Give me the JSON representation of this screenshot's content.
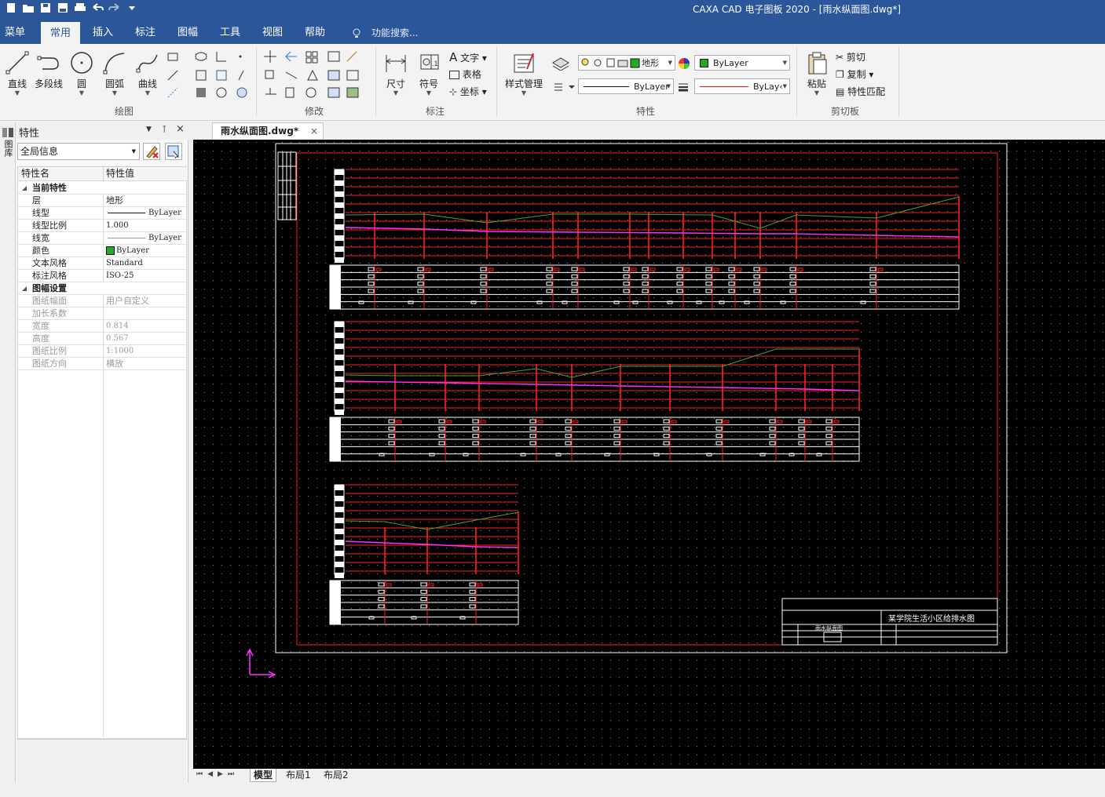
{
  "window": {
    "title": "CAXA CAD 电子图板 2020 - [雨水纵面图.dwg*]"
  },
  "menu": {
    "tabs": [
      "菜单",
      "常用",
      "插入",
      "标注",
      "图幅",
      "工具",
      "视图",
      "帮助"
    ],
    "active_tab": "常用",
    "search_placeholder": "功能搜索..."
  },
  "ribbon": {
    "draw": {
      "group_label": "绘图",
      "line": "直线",
      "polyline": "多段线",
      "circle": "圆",
      "arc": "圆弧",
      "curve": "曲线"
    },
    "modify": {
      "group_label": "修改"
    },
    "annotate": {
      "group_label": "标注",
      "dimension": "尺寸",
      "symbol": "符号",
      "text": "文字",
      "table": "表格",
      "coordinate": "坐标"
    },
    "properties": {
      "group_label": "特性",
      "style_manage": "样式管理",
      "layer_value": "地形",
      "color_value": "ByLayer",
      "linetype_value": "ByLayer",
      "lineweight_value": "ByLay‹"
    },
    "clipboard": {
      "group_label": "剪切板",
      "paste": "粘贴",
      "cut": "剪切",
      "copy": "复制",
      "match": "特性匹配"
    }
  },
  "left_strip": {
    "label": "图库"
  },
  "properties_panel": {
    "title": "特性",
    "scope": "全局信息",
    "col_name": "特性名",
    "col_value": "特性值",
    "groups": [
      {
        "name": "当前特性",
        "rows": [
          {
            "name": "层",
            "value": "地形"
          },
          {
            "name": "线型",
            "value": "ByLayer"
          },
          {
            "name": "线型比例",
            "value": "1.000"
          },
          {
            "name": "线宽",
            "value": "ByLayer"
          },
          {
            "name": "颜色",
            "value": "ByLayer"
          },
          {
            "name": "文本风格",
            "value": "Standard"
          },
          {
            "name": "标注风格",
            "value": "ISO-25"
          }
        ]
      },
      {
        "name": "图幅设置",
        "rows": [
          {
            "name": "图纸幅面",
            "value": "用户自定义"
          },
          {
            "name": "加长系数",
            "value": ""
          },
          {
            "name": "宽度",
            "value": "0.814"
          },
          {
            "name": "高度",
            "value": "0.567"
          },
          {
            "name": "图纸比例",
            "value": "1:1000"
          },
          {
            "name": "图纸方向",
            "value": "横放"
          }
        ]
      }
    ]
  },
  "document": {
    "tab_label": "雨水纵面图.dwg*",
    "close": "×"
  },
  "drawing": {
    "title_block_text": "某学院生活小区给排水图",
    "title_block_sub": "雨水纵面图"
  },
  "layout_tabs": [
    "模型",
    "布局1",
    "布局2"
  ],
  "active_layout": "模型",
  "colors": {
    "title_bg": "#2b579a",
    "canvas": "#000000",
    "frame": "#ffffff",
    "red": "#ff2020",
    "magenta": "#ff30ff",
    "green": "#3aa83a",
    "bylayer_green": "#22aa22"
  }
}
